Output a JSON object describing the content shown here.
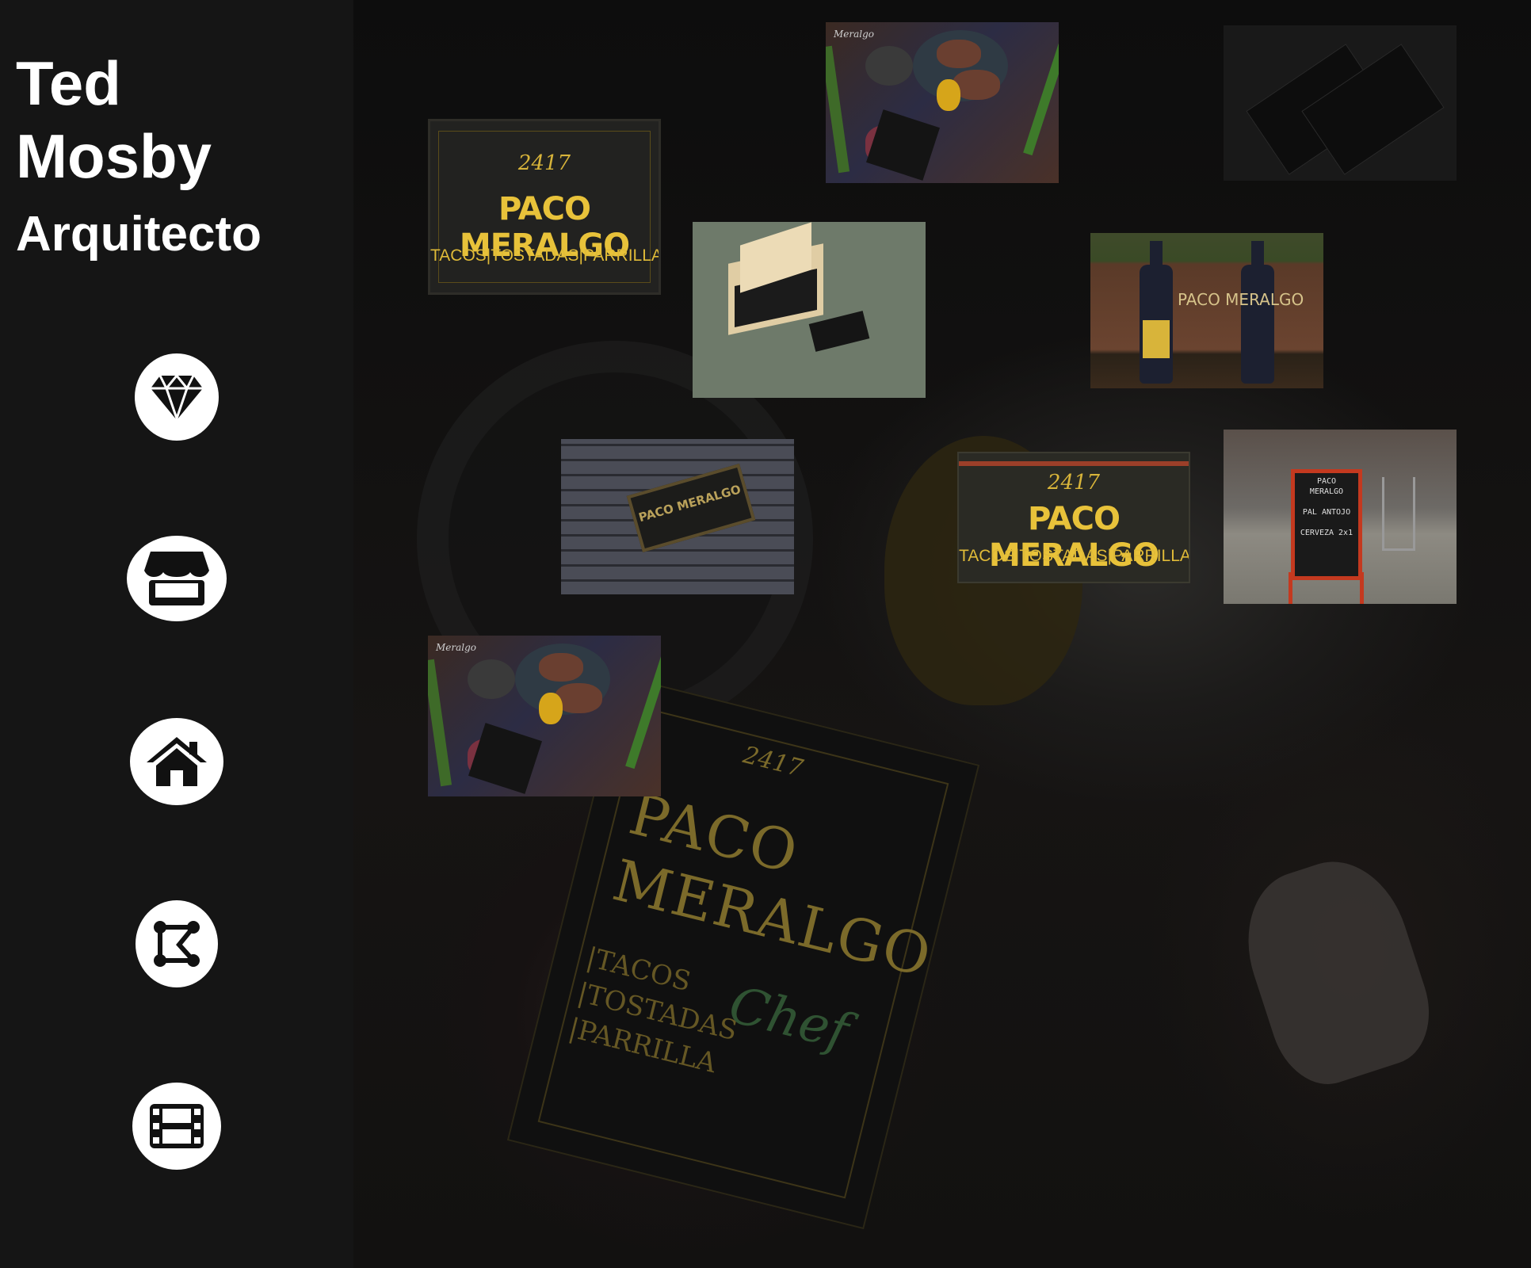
{
  "sidebar": {
    "name_line1": "Ted",
    "name_line2": "Mosby",
    "role": "Arquitecto",
    "nav": [
      {
        "icon": "diamond-icon"
      },
      {
        "icon": "store-icon"
      },
      {
        "icon": "home-icon"
      },
      {
        "icon": "vector-shape-icon"
      },
      {
        "icon": "film-icon"
      }
    ]
  },
  "background": {
    "menu_number": "2417",
    "menu_title_1": "PACO",
    "menu_title_2": "MERALGO",
    "menu_sub_1": "|TACOS",
    "menu_sub_2": "|TOSTADAS",
    "menu_sub_3": "|PARRILLA",
    "menu_chef": "Chef"
  },
  "gallery": {
    "logo": {
      "number": "2417",
      "title": "PACO MERALGO",
      "subtitle": "TACOS|TOSTADAS|PARRILLA"
    },
    "exterior": {
      "number": "2417",
      "title": "PACO MERALGO",
      "subtitle": "TACOS|TOSTADAS|PARRILLA"
    },
    "food_label": "Meralgo",
    "bottle_text": "PACO MERALGO",
    "sign_text": "PACO MERALGO",
    "board_text": "PACO\nMERALGO\n\nPAL ANTOJO\n\nCERVEZA 2x1\n\n"
  },
  "colors": {
    "sidebar_bg": "#151515",
    "accent_gold": "#e8c23a",
    "nav_circle": "#ffffff"
  }
}
